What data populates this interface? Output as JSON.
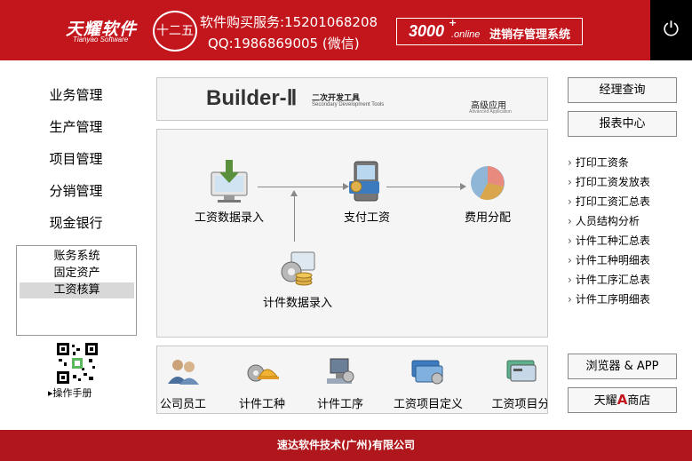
{
  "header": {
    "logo": "天耀软件",
    "logo_sub": "Tianyao Software",
    "seal": "十二五",
    "service": "软件购买服务:15201068208",
    "qq": "QQ:1986869005 (微信)",
    "product_num": "3000",
    "product_sup": "+",
    "product_online": ".online",
    "product_name": "进销存管理系统"
  },
  "nav": {
    "items": [
      "业务管理",
      "生产管理",
      "项目管理",
      "分销管理",
      "现金银行"
    ],
    "sub_items": [
      "账务系统",
      "固定资产",
      "工资核算"
    ],
    "selected_sub": "工资核算",
    "manual": "操作手册"
  },
  "builder": {
    "title": "Builder-Ⅱ",
    "cn": "二次开发工具",
    "en": "Secondary Development Tools",
    "advanced": "高级应用",
    "advanced_en": "Advanced Application"
  },
  "flow": {
    "nodes": [
      "工资数据录入",
      "支付工资",
      "费用分配",
      "计件数据录入"
    ]
  },
  "modules": [
    "公司员工",
    "计件工种",
    "计件工序",
    "工资项目定义",
    "工资项目分"
  ],
  "right": {
    "top_buttons": [
      "经理查询",
      "报表中心"
    ],
    "links": [
      "打印工资条",
      "打印工资发放表",
      "打印工资汇总表",
      "人员结构分析",
      "计件工种汇总表",
      "计件工种明细表",
      "计件工序汇总表",
      "计件工序明细表"
    ],
    "bottom_buttons": [
      "浏览器 & APP",
      "天耀",
      "商店"
    ],
    "store_mark": "A"
  },
  "footer": "速达软件技术(广州)有限公司",
  "colors": {
    "header_red": "#c2161c",
    "footer_red": "#b0171c",
    "power_bg": "#000000"
  }
}
